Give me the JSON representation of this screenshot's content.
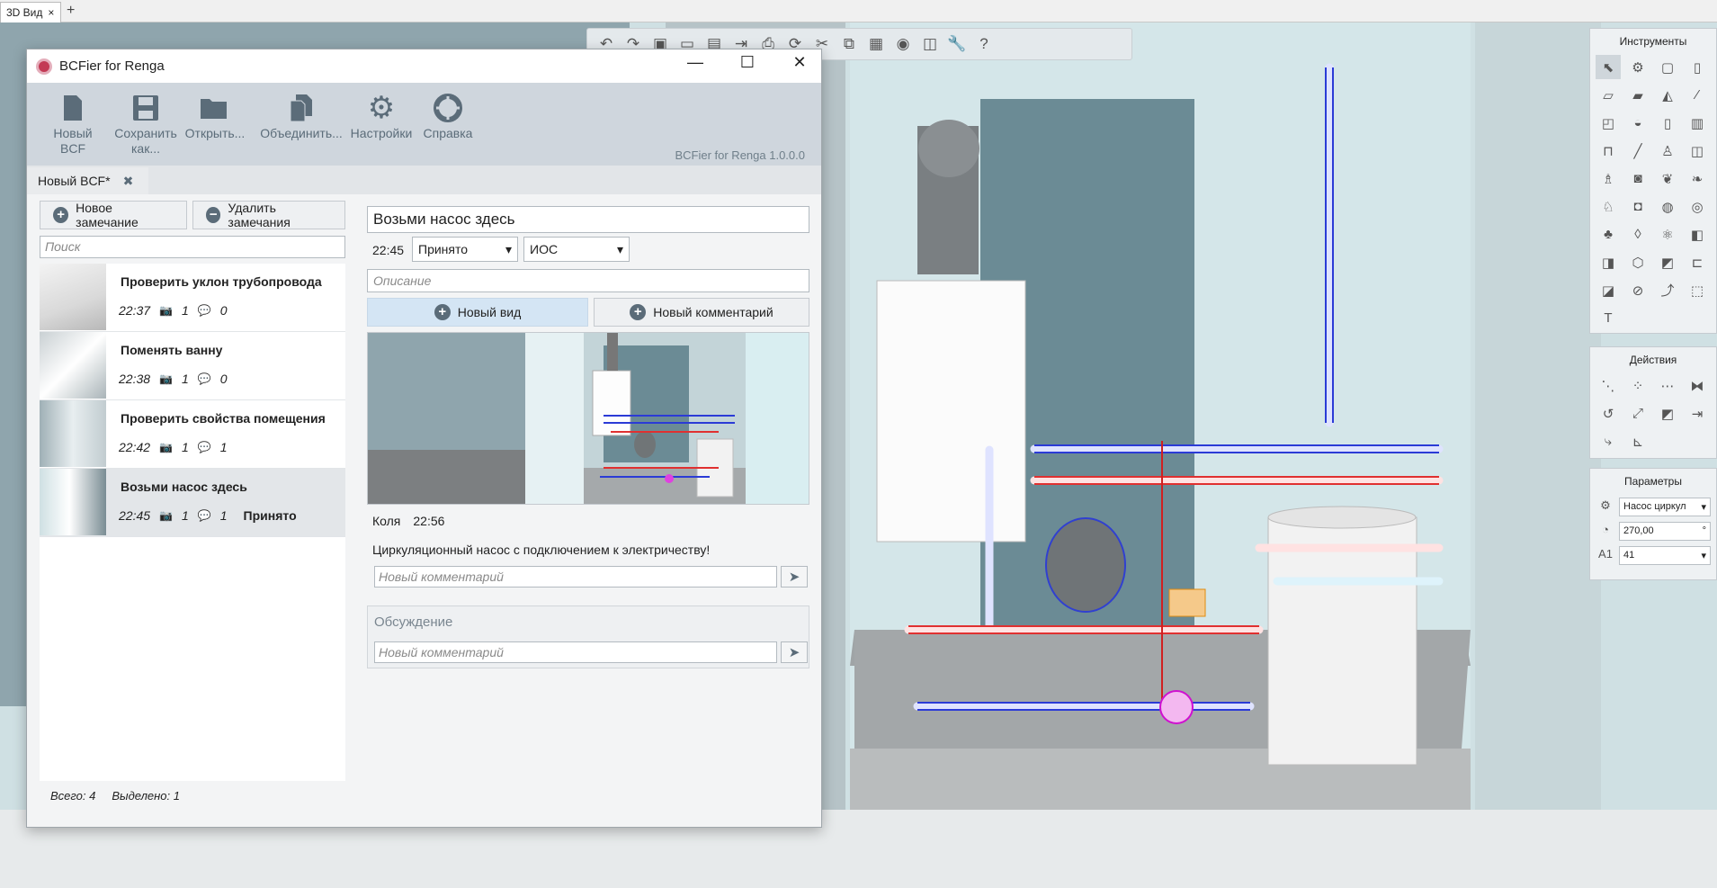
{
  "tabbar": {
    "tab_label": "3D Вид",
    "close": "×",
    "add": "+"
  },
  "toolbar": {
    "icons": [
      "undo-icon",
      "redo-icon",
      "view-cube-icon",
      "open-icon",
      "save-icon",
      "export-icon",
      "print-icon",
      "orbit-icon",
      "cut-icon",
      "copy-icon",
      "paste-icon",
      "renga-icon",
      "layers-icon",
      "wrench-icon",
      "help-icon"
    ]
  },
  "instruments": {
    "title": "Инструменты",
    "text_tool": "T"
  },
  "actions": {
    "title": "Действия"
  },
  "params": {
    "title": "Параметры",
    "type_value": "Насос циркул",
    "angle_value": "270,00",
    "angle_unit": "°",
    "level_value": "41"
  },
  "window": {
    "title": "BCFier for Renga",
    "minimize": "—",
    "maximize": "☐",
    "close": "✕"
  },
  "ribbon": {
    "new_bcf": "Новый BCF",
    "save_as_1": "Сохранить",
    "save_as_2": "как...",
    "open": "Открыть...",
    "merge": "Объединить...",
    "settings": "Настройки",
    "help": "Справка",
    "version": "BCFier for Renga 1.0.0.0"
  },
  "doc_tab": {
    "label": "Новый BCF*",
    "close": "✖"
  },
  "left": {
    "new_issue": "Новое замечание",
    "delete_issues": "Удалить замечания",
    "search_placeholder": "Поиск",
    "issues": [
      {
        "title": "Проверить уклон трубопровода",
        "time": "22:37",
        "views": "1",
        "comments": "0",
        "status": ""
      },
      {
        "title": "Поменять ванну",
        "time": "22:38",
        "views": "1",
        "comments": "0",
        "status": ""
      },
      {
        "title": "Проверить свойства помещения",
        "time": "22:42",
        "views": "1",
        "comments": "1",
        "status": ""
      },
      {
        "title": "Возьми насос здесь",
        "time": "22:45",
        "views": "1",
        "comments": "1",
        "status": "Принято"
      }
    ],
    "total": "Всего: 4",
    "selected": "Выделено: 1"
  },
  "detail": {
    "topic": "Возьми насос здесь",
    "time": "22:45",
    "status": "Принято",
    "type": "ИОС",
    "description_placeholder": "Описание",
    "new_view": "Новый вид",
    "new_comment_btn": "Новый комментарий",
    "comment_author": "Коля",
    "comment_time": "22:56",
    "comment_text": "Циркуляционный насос с подключением к электричеству!",
    "comment_placeholder": "Новый комментарий",
    "discussion_title": "Обсуждение",
    "discussion_placeholder": "Новый комментарий"
  }
}
